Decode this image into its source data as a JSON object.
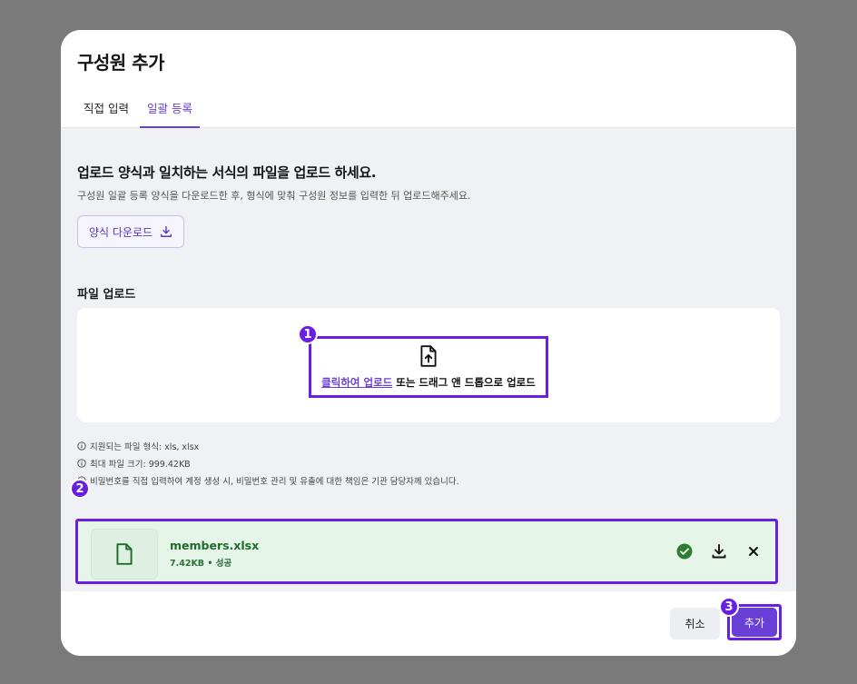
{
  "modal": {
    "title": "구성원 추가",
    "tabs": [
      {
        "label": "직접 입력",
        "active": false
      },
      {
        "label": "일괄 등록",
        "active": true
      }
    ]
  },
  "body": {
    "heading": "업로드 양식과 일치하는 서식의 파일을 업로드 하세요.",
    "description": "구성원 일괄 등록 양식을 다운로드한 후, 형식에 맞춰 구성원 정보를 입력한 뒤 업로드해주세요.",
    "template_button": {
      "label": "양식 다운로드",
      "icon": "download-icon"
    },
    "upload_label": "파일 업로드",
    "dropzone": {
      "icon": "file-upload-icon",
      "link_text": "클릭하여 업로드",
      "rest_text": " 또는 드래그 앤 드롭으로 업로드"
    },
    "info": [
      "지원되는 파일 형식: xls, xlsx",
      "최대 파일 크기: 999.42KB",
      "비밀번호를 직접 입력하여 계정 생성 시, 비밀번호 관리 및 유출에 대한 책임은 기관 담당자께 있습니다."
    ],
    "file": {
      "name": "members.xlsx",
      "meta": "7.42KB • 성공",
      "status": "success"
    }
  },
  "footer": {
    "cancel_label": "취소",
    "add_label": "추가"
  },
  "badges": [
    "1",
    "2",
    "3"
  ],
  "colors": {
    "accent": "#6a3fd8",
    "highlight": "#6a1fe0",
    "success_bg": "#e5f5e8",
    "success_text": "#1e6b2a",
    "success_icon": "#2e7d32"
  }
}
